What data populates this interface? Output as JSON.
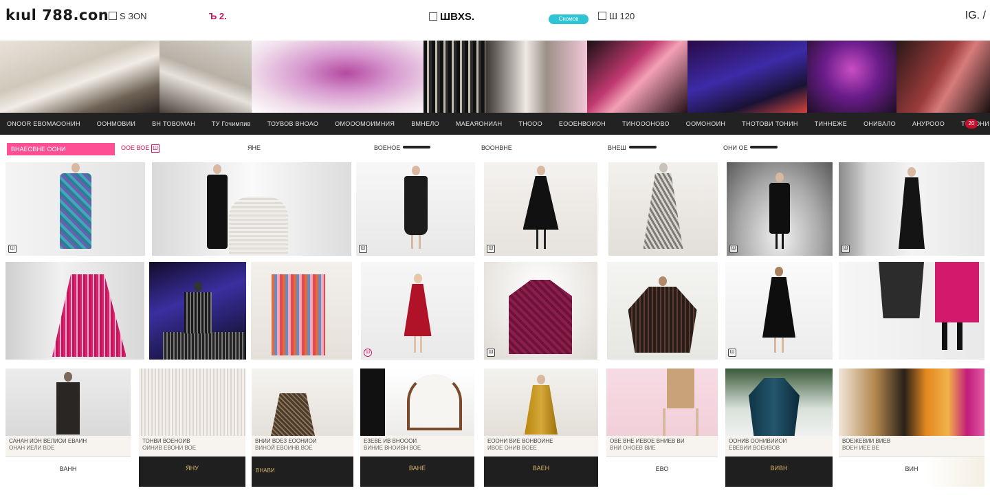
{
  "header": {
    "logo": "kıul 788.con",
    "links": [
      {
        "text": "S ЗОN",
        "style": "plain"
      },
      {
        "text": "Ъ 2.",
        "style": "pink"
      },
      {
        "text": "ШBXS.",
        "style": "brand"
      },
      {
        "text": "Ш 120",
        "style": "plain"
      }
    ],
    "pill": "Сномов",
    "right": "IG. /"
  },
  "categories": [
    "ONOOR ЕВОМАООНИН",
    "ООНМОВИИ",
    "ВН ТОВОМАН",
    "ТУ Гочимпив",
    "ТОУВОВ ВНОАО",
    "ОМОООМОИМНИЯ",
    "ВМНЕЛО",
    "МАЕАЯОНИАН",
    "ТНООО",
    "ЕООЕНВОИОН",
    "ТИНОООНОВО",
    "ООМОНОИН",
    "ТНОТОВИ ТОНИН",
    "ТИННЕЖЕ",
    "ОНИВАЛО",
    "АНУРООО",
    "ТОООНИ ТОНАВ"
  ],
  "cart_count": "20",
  "filters": {
    "active": "ВНАЕОВНЕ ООНИ",
    "items": [
      "ООЕ ВОЕ",
      "ЯНЕ",
      "ВОЕНОЕ",
      "ВООНВНЕ",
      "ВНЕШ",
      "ОНИ ОЕ"
    ]
  },
  "products_row1": [
    {
      "mark": "Ш"
    },
    {
      "mark": ""
    },
    {
      "mark": "Ш"
    },
    {
      "mark": "Ш"
    },
    {
      "mark": ""
    },
    {
      "mark": "Ш"
    },
    {
      "mark": "Ш"
    }
  ],
  "products_row2": [
    {
      "mark": ""
    },
    {
      "mark": ""
    },
    {
      "mark": ""
    },
    {
      "mark": "Ш"
    },
    {
      "mark": "Ш"
    },
    {
      "mark": ""
    },
    {
      "mark": "Ш"
    },
    {
      "mark": ""
    }
  ],
  "products_row3": [
    {
      "c1": "САНАН ИОН ВЕЛИОИ ЕВАИН",
      "c2": "ОНАН ИЕЛИ ВОЕ",
      "price": "ВАНН"
    },
    {
      "c1": "ТОНВИ ВОЕНОИВ",
      "c2": "ОИНИВ ЕВОНИ ВОЕ",
      "price": "ЯНУ"
    },
    {
      "c1": "ВНИИ ВОЕЗ ЕООНИОИ",
      "c2": "ВИНОЙ ЕВОИНВ ВОЕ",
      "price": "ВНАВИ"
    },
    {
      "c1": "ЕЗЕВЕ ИВ ВНОООИ",
      "c2": "ВИНИЕ ВНОИВН ВОЕ",
      "price": "ВАНЕ"
    },
    {
      "c1": "ЕООНИ ВИЕ ВОНВОИНЕ",
      "c2": "ИВОЕ ОНИВ ВОЕЕ",
      "price": "ВАЕН"
    },
    {
      "c1": "ОВЕ ВНЕ ИЕВОЕ ВНИЕВ ВИ",
      "c2": "ВНИ ОНОЕВ ВИЕ",
      "price": "ЕВО"
    },
    {
      "c1": "ООНИВ ООНИВИИОИ",
      "c2": "ЕВЕВИИ ВОЕИВОВ",
      "price": "ВИВН"
    },
    {
      "c1": "ВОЕЖЕВИИ ВИЕВ",
      "c2": "ВОЕН ИЕЕ ВЕ",
      "price": "ВИН"
    }
  ]
}
